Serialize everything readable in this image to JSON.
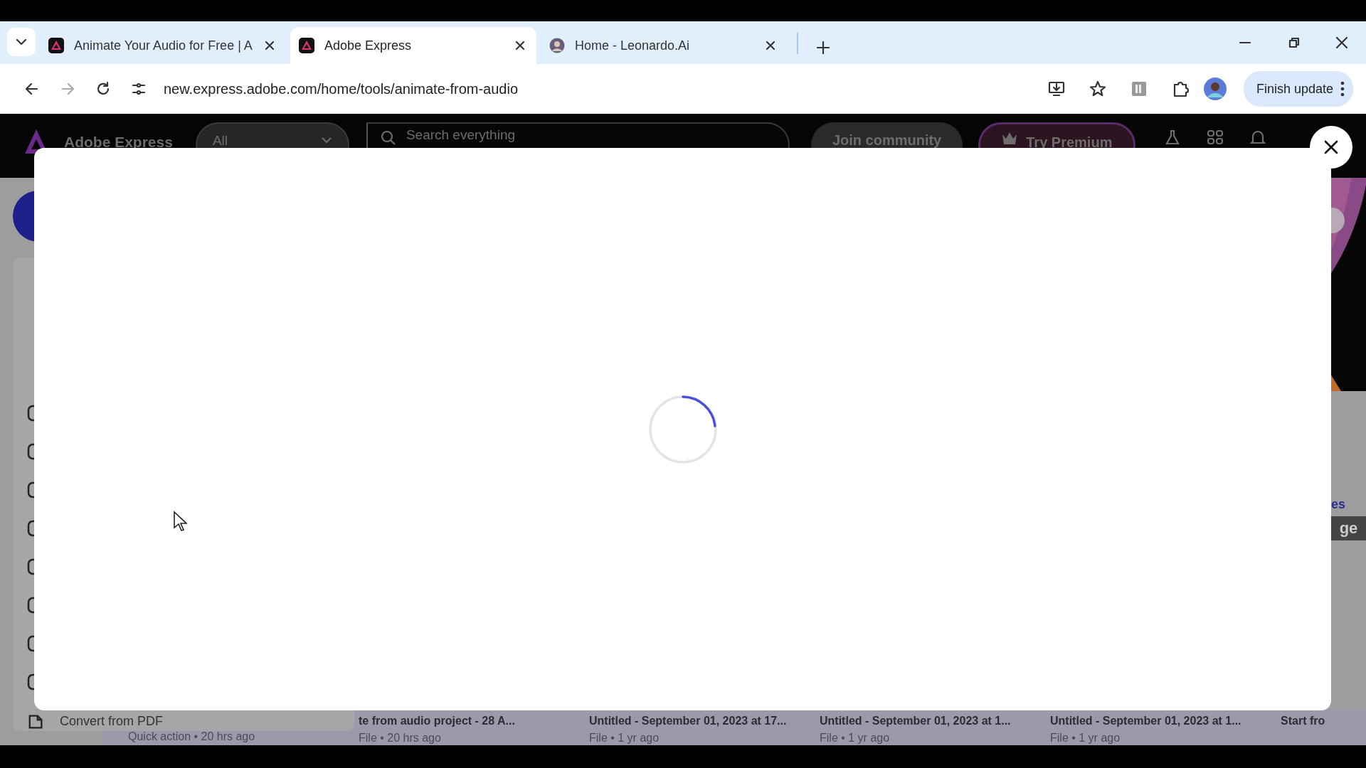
{
  "browser": {
    "tabs": [
      {
        "title": "Animate Your Audio for Free | A",
        "kind": "adobe",
        "selected": false
      },
      {
        "title": "Adobe Express",
        "kind": "adobe",
        "selected": true
      },
      {
        "title": "Home - Leonardo.Ai",
        "kind": "leonardo",
        "selected": false
      }
    ],
    "url": "new.express.adobe.com/home/tools/animate-from-audio",
    "update_button": "Finish update"
  },
  "app_header": {
    "brand": "Adobe Express",
    "scope": "All",
    "search_placeholder": "Search everything",
    "buttons": [
      "Join community",
      "Try Premium"
    ]
  },
  "modal": {
    "loading": true
  },
  "sidebar": {
    "items": [
      {
        "label": "Convert from PDF"
      }
    ]
  },
  "recents": [
    {
      "meta": "Quick action • 20 hrs ago"
    },
    {
      "title": "te from audio project - 28 A...",
      "meta": "File • 20 hrs ago"
    },
    {
      "title": "Untitled - September 01, 2023 at 17...",
      "meta": "File • 1 yr ago"
    },
    {
      "title": "Untitled - September 01, 2023 at 1...",
      "meta": "File • 1 yr ago"
    },
    {
      "title": "Untitled - September 01, 2023 at 1...",
      "meta": "File • 1 yr ago"
    },
    {
      "title": "Start fro"
    }
  ],
  "side_texts": [
    {
      "text": "es",
      "kind": "link"
    },
    {
      "text": "ge",
      "kind": "button"
    }
  ]
}
